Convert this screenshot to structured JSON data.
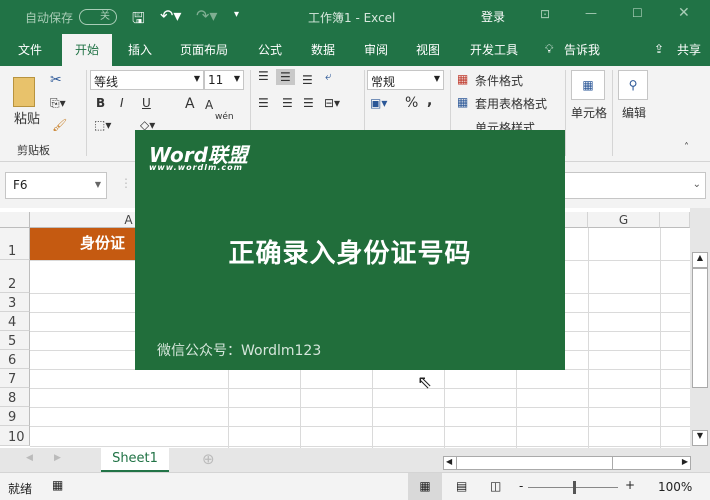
{
  "titlebar": {
    "autosave": "自动保存",
    "autosave_state": "关",
    "title": "工作簿1  -  Excel",
    "login": "登录"
  },
  "tabs": [
    "文件",
    "开始",
    "插入",
    "页面布局",
    "公式",
    "数据",
    "审阅",
    "视图",
    "开发工具",
    "告诉我"
  ],
  "share": "共享",
  "ribbon": {
    "paste": "粘贴",
    "clipboard": "剪贴板",
    "font": "等线",
    "size": "11",
    "bold": "B",
    "italic": "I",
    "underline": "U",
    "grow": "A",
    "shrink": "A",
    "phonetic": "wén",
    "number_format": "常规",
    "percent": "%",
    "comma": ",",
    "cond_format": "条件格式",
    "table_format": "套用表格格式",
    "cell_style": "单元格样式",
    "cells": "单元格",
    "edit": "编辑"
  },
  "namebox": "F6",
  "columns": [
    "A",
    "G"
  ],
  "rows": [
    "1",
    "2",
    "3",
    "4",
    "5",
    "6",
    "7",
    "8",
    "9",
    "10"
  ],
  "cell_a1": "身份证",
  "overlay": {
    "logo": "Word联盟",
    "logo_url": "www.wordlm.com",
    "title": "正确录入身份证号码",
    "footer": "微信公众号：Wordlm123"
  },
  "sheet": "Sheet1",
  "status": {
    "ready": "就绪",
    "zoom": "100%"
  },
  "colors": {
    "accent": "#217346",
    "header_fill": "#c55a11",
    "overlay": "#216e3b"
  }
}
